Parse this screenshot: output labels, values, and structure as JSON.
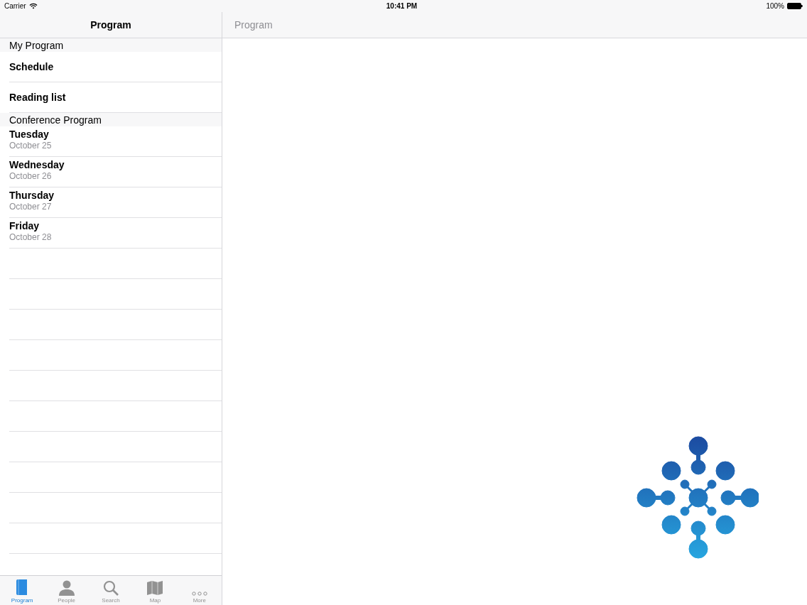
{
  "status_bar": {
    "carrier": "Carrier",
    "time": "10:41 PM",
    "battery": "100%"
  },
  "master": {
    "title": "Program",
    "sections": [
      {
        "header": "My Program",
        "rows": [
          {
            "title": "Schedule"
          },
          {
            "title": "Reading list"
          }
        ]
      },
      {
        "header": "Conference Program",
        "rows": [
          {
            "title": "Tuesday",
            "subtitle": "October 25"
          },
          {
            "title": "Wednesday",
            "subtitle": "October 26"
          },
          {
            "title": "Thursday",
            "subtitle": "October 27"
          },
          {
            "title": "Friday",
            "subtitle": "October 28"
          }
        ]
      }
    ]
  },
  "detail": {
    "title": "Program"
  },
  "tabs": [
    {
      "label": "Program",
      "kind": "book",
      "selected": true
    },
    {
      "label": "People",
      "kind": "person",
      "selected": false
    },
    {
      "label": "Search",
      "kind": "search",
      "selected": false
    },
    {
      "label": "Map",
      "kind": "map",
      "selected": false
    },
    {
      "label": "More",
      "kind": "more",
      "selected": false
    }
  ]
}
